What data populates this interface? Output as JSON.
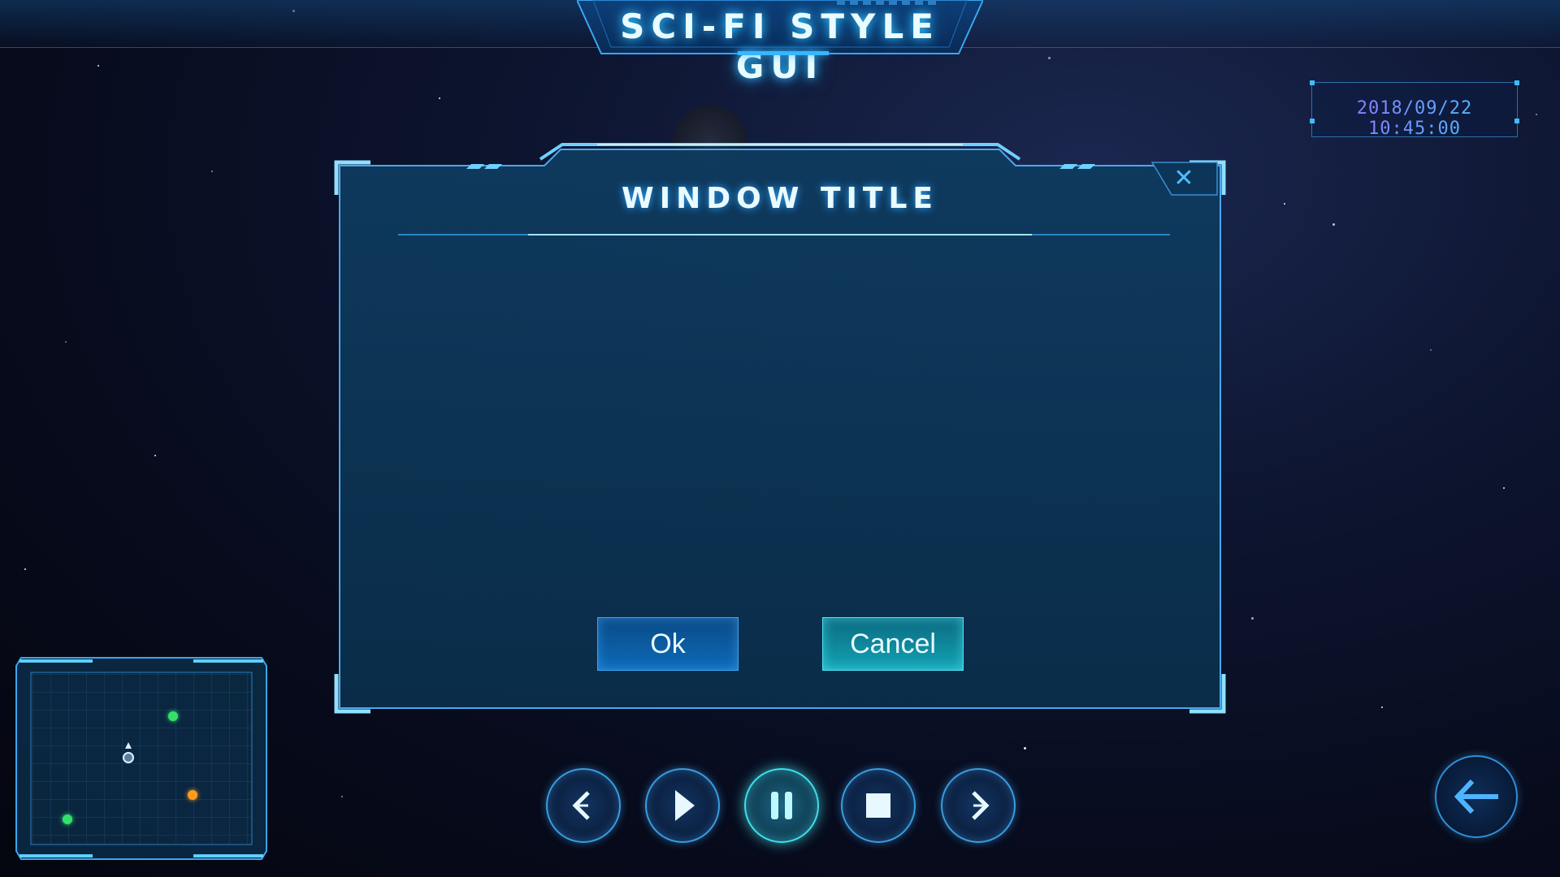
{
  "header": {
    "title": "SCI-FI STYLE GUI"
  },
  "datetime": "2018/09/22 10:45:00",
  "dialog": {
    "title": "WINDOW TITLE",
    "close_icon": "close-icon",
    "ok_label": "Ok",
    "cancel_label": "Cancel"
  },
  "minimap": {
    "markers": [
      {
        "kind": "player",
        "color": "#d9f2ff",
        "icon": "player-marker-icon"
      },
      {
        "kind": "ally",
        "color": "#35e06a"
      },
      {
        "kind": "ally",
        "color": "#35e06a"
      },
      {
        "kind": "objective",
        "color": "#ff9a1f"
      }
    ]
  },
  "media_controls": [
    {
      "name": "previous",
      "icon": "chevron-left-icon"
    },
    {
      "name": "play",
      "icon": "play-icon"
    },
    {
      "name": "pause",
      "icon": "pause-icon",
      "active": true
    },
    {
      "name": "stop",
      "icon": "stop-icon"
    },
    {
      "name": "next",
      "icon": "chevron-right-icon"
    }
  ],
  "back_button": {
    "icon": "arrow-left-icon"
  },
  "colors": {
    "accent": "#37b6ff",
    "cyan": "#3fe0ee",
    "panel": "#0d3a5a",
    "background": "#070b1c"
  }
}
